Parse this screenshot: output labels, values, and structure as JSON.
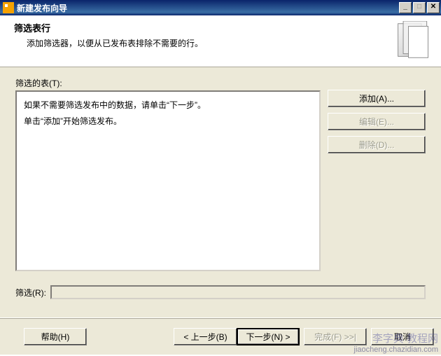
{
  "titlebar": {
    "title": "新建发布向导"
  },
  "header": {
    "title": "筛选表行",
    "desc": "添加筛选器，以便从已发布表排除不需要的行。"
  },
  "filteredTables": {
    "label": "筛选的表(T):",
    "line1": "如果不需要筛选发布中的数据，请单击“下一步”。",
    "line2": "单击“添加”开始筛选发布。"
  },
  "buttons": {
    "add": "添加(A)...",
    "edit": "编辑(E)...",
    "delete": "删除(D)..."
  },
  "filterRow": {
    "label": "筛选(R):"
  },
  "footer": {
    "help": "帮助(H)",
    "back": "< 上一步(B)",
    "next": "下一步(N) >",
    "finish": "完成(F) >>|",
    "cancel": "取消"
  },
  "watermark": {
    "l1": "李字典  教程网",
    "l2": "jiaocheng.chazidian.com"
  }
}
